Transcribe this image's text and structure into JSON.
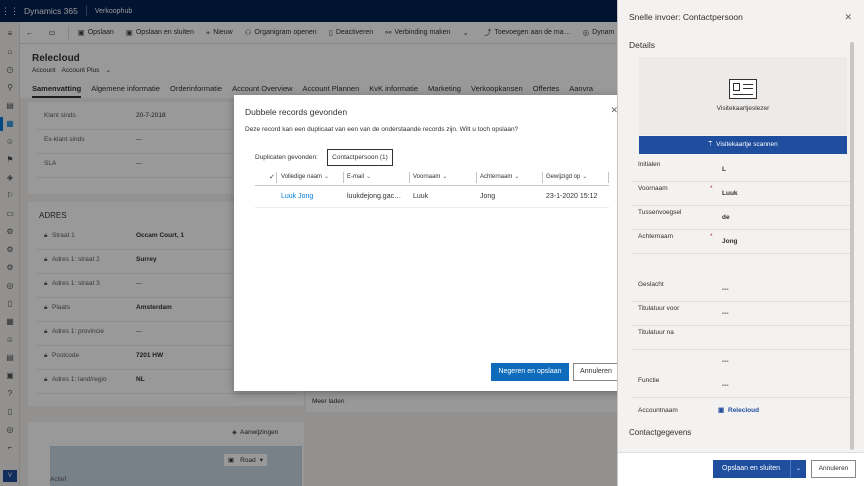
{
  "topbar": {
    "brand": "Dynamics 365",
    "app": "Verkoophub"
  },
  "commands": {
    "save": "Opslaan",
    "save_close": "Opslaan en sluiten",
    "new": "Nieuw",
    "org_chart": "Organigram openen",
    "deactivate": "Deactiveren",
    "connect": "Verbinding maken",
    "add_to": "Toevoegen aan de ma…",
    "dynamics": "Dynam"
  },
  "record": {
    "title": "Relecloud",
    "type": "Account",
    "form": "Account Plus",
    "tabs": [
      "Samenvatting",
      "Algemene informatie",
      "Orderinformatie",
      "Account Overview",
      "Account Plannen",
      "KvK informatie",
      "Marketing",
      "Verkoopkansen",
      "Offertes",
      "Aanvra"
    ]
  },
  "fields_top": [
    {
      "label": "Klant sinds",
      "value": "20-7-2018"
    },
    {
      "label": "Ex-klant sinds",
      "value": "---"
    },
    {
      "label": "SLA",
      "value": "---"
    }
  ],
  "address": {
    "header": "ADRES",
    "fields": [
      {
        "label": "Straat 1",
        "value": "Occam Court, 1"
      },
      {
        "label": "Adres 1: straat 2",
        "value": "Surrey"
      },
      {
        "label": "Adres 1: straat 3",
        "value": "---"
      },
      {
        "label": "Plaats",
        "value": "Amsterdam"
      },
      {
        "label": "Adres 1: provincie",
        "value": "---"
      },
      {
        "label": "Postcode",
        "value": "7201 HW"
      },
      {
        "label": "Adres 1: land/regio",
        "value": "NL"
      }
    ]
  },
  "map": {
    "directions": "Aanwijzingen",
    "road": "Road",
    "more": "Meer laden",
    "bottom_label": "Actief"
  },
  "dialog": {
    "title": "Dubbele records gevonden",
    "description": "Deze record kan een duplicaat van een van de onderstaande records zijn. Wilt u toch opslaan?",
    "duplicates_label": "Duplicaten gevonden:",
    "chip": "Contactpersoon (1)",
    "columns": [
      "Volledige naam",
      "E-mail",
      "Voornaam",
      "Achternaam",
      "Gewijzigd op"
    ],
    "row": {
      "fullname": "Luuk Jong",
      "email": "luukdejong.gac…",
      "firstname": "Luuk",
      "lastname": "Jong",
      "modified": "23-1-2020 15:12"
    },
    "primary_button": "Negeren en opslaan",
    "cancel_button": "Annuleren"
  },
  "quickcreate": {
    "title": "Snelle invoer: Contactpersoon",
    "details_header": "Details",
    "card_reader": "Visitekaartjeslezer",
    "scan_button": "Visitekaartje scannen",
    "fields": [
      {
        "label": "Initialen",
        "value": "L",
        "required": false
      },
      {
        "label": "Voornaam",
        "value": "Luuk",
        "required": true
      },
      {
        "label": "Tussenvoegsel",
        "value": "de",
        "required": false
      },
      {
        "label": "Achternaam",
        "value": "Jong",
        "required": true
      },
      {
        "label": "Geslacht",
        "value": "---",
        "required": false
      },
      {
        "label": "Titulatuur voor",
        "value": "---",
        "required": false
      },
      {
        "label": "Titulatuur na",
        "value": "---",
        "required": false
      },
      {
        "label": "Functie",
        "value": "---",
        "required": false
      },
      {
        "label": "Accountnaam",
        "value": "Relecloud",
        "required": false
      }
    ],
    "contact_header": "Contactgegevens",
    "save_button": "Opslaan en sluiten",
    "cancel_button": "Annuleren"
  }
}
